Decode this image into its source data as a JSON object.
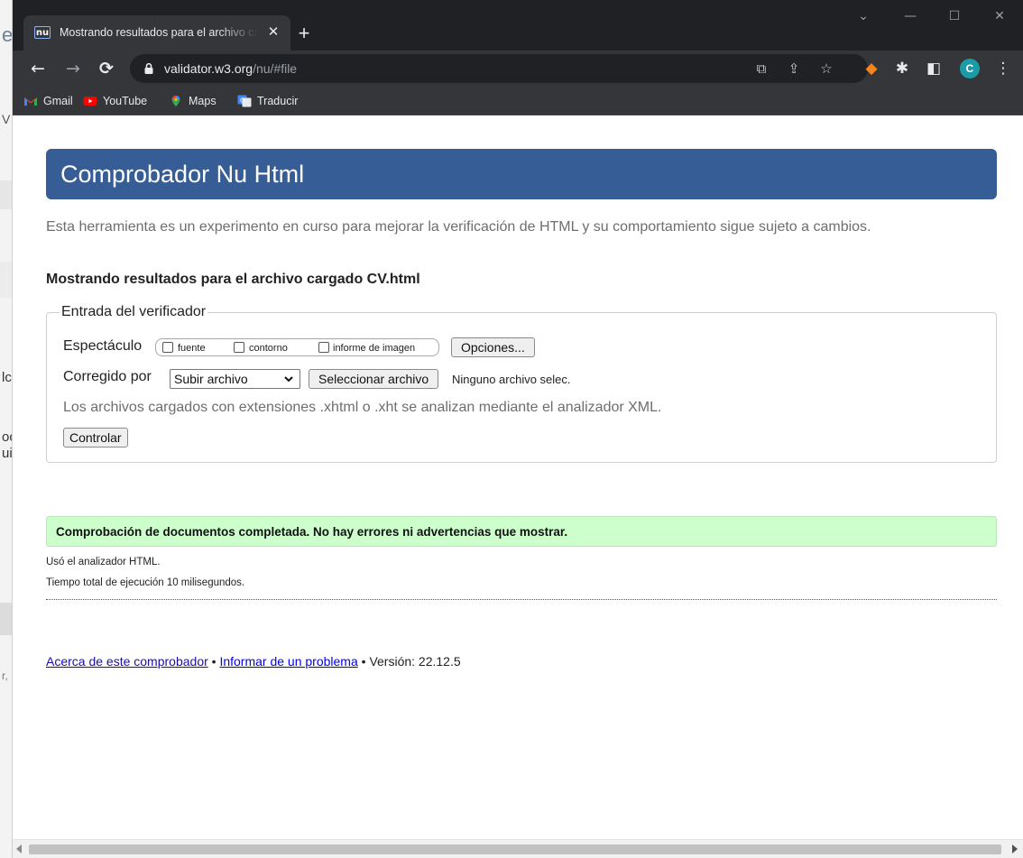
{
  "browser": {
    "tab_title": "Mostrando resultados para el archivo cargado CV.html",
    "tab_favicon": "nu",
    "url_host": "validator.w3.org",
    "url_path": "/nu/#file",
    "avatar_letter": "C",
    "bookmarks": [
      "Gmail",
      "YouTube",
      "Maps",
      "Traducir"
    ],
    "icons": {
      "back": "arrow-left",
      "forward": "arrow-right",
      "reload": "reload",
      "translate": "translate",
      "share": "share",
      "star": "star",
      "fox": "metamask-extension",
      "puzzle": "extensions",
      "sidepanel": "side-panel",
      "menu": "three-dots"
    }
  },
  "background_window": {
    "glyphs": [
      "e",
      "V",
      "lc",
      "oc",
      "ui",
      "r,"
    ]
  },
  "page": {
    "banner_title": "Comprobador Nu Html",
    "intro": "Esta herramienta es un experimento en curso para mejorar la verificación de HTML y su comportamiento sigue sujeto a cambios.",
    "results_heading": "Mostrando resultados para el archivo cargado CV.html",
    "form": {
      "legend": "Entrada del verificador",
      "show_label": "Espectáculo",
      "checkboxes": [
        "fuente",
        "contorno",
        "informe de imagen"
      ],
      "options_button": "Opciones...",
      "by_label": "Corregido por",
      "select_value": "Subir archivo",
      "file_button": "Seleccionar archivo",
      "file_status": "Ninguno archivo selec.",
      "xml_note": "Los archivos cargados con extensiones .xhtml o .xht se analizan mediante el analizador XML.",
      "submit_button": "Controlar"
    },
    "result": {
      "success": "Comprobación de documentos completada. No hay errores ni advertencias que mostrar.",
      "parser_note": "Usó el analizador HTML.",
      "time_note": "Tiempo total de ejecución 10 milisegundos."
    },
    "footer": {
      "about_link": "Acerca de este comprobador",
      "sep": "•",
      "report_link": "Informar de un problema",
      "version": "• Versión: 22.12.5"
    }
  },
  "colors": {
    "banner": "#365d95",
    "success_bg": "#ccffcc",
    "chrome_dark": "#202124",
    "chrome_toolbar": "#35363a"
  }
}
